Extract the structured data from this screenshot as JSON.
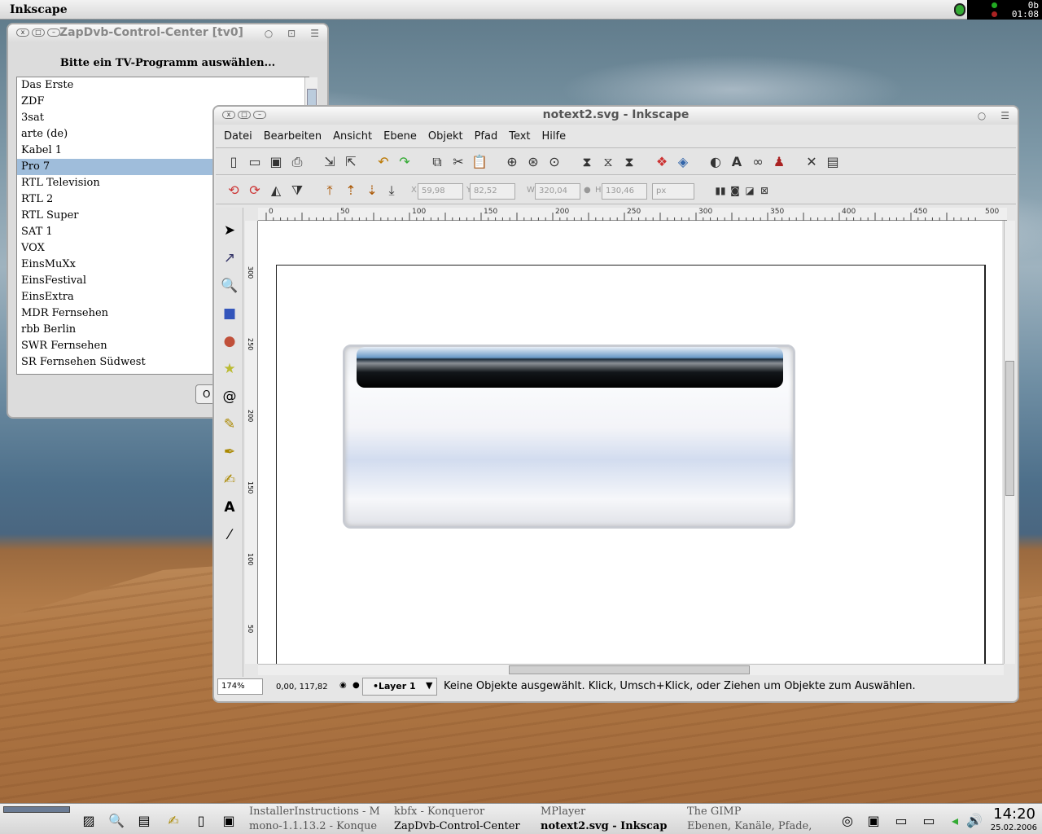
{
  "top_panel": {
    "app_title": "Inkscape",
    "tray_line1": "0b",
    "tray_line2": "01:08"
  },
  "zapdvb": {
    "title": "ZapDvb-Control-Center [tv0]",
    "prompt": "Bitte ein TV-Programm auswählen...",
    "channels": [
      "Das Erste",
      "ZDF",
      "3sat",
      "arte (de)",
      "Kabel 1",
      "Pro 7",
      "RTL Television",
      "RTL 2",
      "RTL Super",
      "SAT 1",
      "VOX",
      "EinsMuXx",
      "EinsFestival",
      "EinsExtra",
      "MDR Fernsehen",
      "rbb Berlin",
      "SWR Fernsehen",
      "SR Fernsehen Südwest"
    ],
    "selected": "Pro 7",
    "button_label": "O"
  },
  "inkscape": {
    "title": "notext2.svg - Inkscape",
    "menu": [
      "Datei",
      "Bearbeiten",
      "Ansicht",
      "Ebene",
      "Objekt",
      "Pfad",
      "Text",
      "Hilfe"
    ],
    "fields": {
      "x_label": "X",
      "x": "59,98",
      "y_label": "Y",
      "y": "82,52",
      "w_label": "W",
      "w": "320,04",
      "h_label": "H",
      "h": "130,46",
      "unit": "px"
    },
    "ruler_ticks": [
      "0",
      "50",
      "100",
      "150",
      "200",
      "250",
      "300",
      "350",
      "400",
      "450",
      "500"
    ],
    "vruler_ticks": [
      "300",
      "250",
      "200",
      "150",
      "100",
      "50"
    ],
    "zoom": "174%",
    "coords": "0,00, 117,82",
    "layer": "•Layer 1",
    "status": "Keine Objekte ausgewählt. Klick, Umsch+Klick, oder Ziehen um Objekte zum Auswählen."
  },
  "taskbar": {
    "tasks_top": [
      "InstallerInstructions - M",
      "kbfx - Konqueror",
      "MPlayer",
      "The GIMP"
    ],
    "tasks_bottom": [
      "mono-1.1.13.2 - Konque",
      "ZapDvb-Control-Center",
      "notext2.svg - Inkscap",
      "Ebenen, Kanäle, Pfade,"
    ],
    "clock": "14:20",
    "date": "25.02.2006"
  }
}
